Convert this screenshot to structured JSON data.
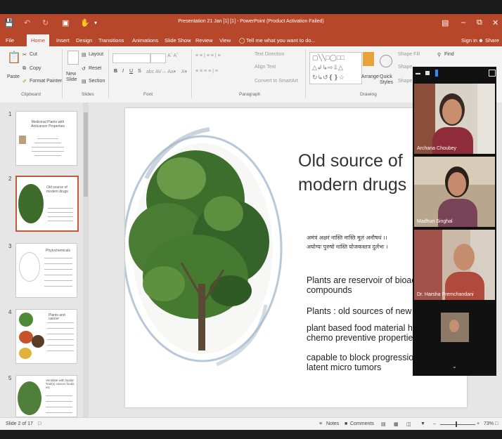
{
  "window": {
    "title": "Presentation 21 Jan [1] [1] - PowerPoint (Product Activation Failed)",
    "sign_in": "Sign in",
    "share": "Share"
  },
  "menu": {
    "file": "File",
    "tabs": [
      "Home",
      "Insert",
      "Design",
      "Transitions",
      "Animations",
      "Slide Show",
      "Review",
      "View"
    ],
    "tell_me": "Tell me what you want to do..."
  },
  "ribbon": {
    "clipboard": {
      "paste": "Paste",
      "cut": "Cut",
      "copy": "Copy",
      "format_painter": "Format Painter",
      "label": "Clipboard"
    },
    "slides": {
      "new_slide": "New Slide",
      "layout": "Layout",
      "reset": "Reset",
      "section": "Section",
      "label": "Slides"
    },
    "font": {
      "label": "Font",
      "bold": "B",
      "italic": "I",
      "underline": "U",
      "strike": "S"
    },
    "paragraph": {
      "text_direction": "Text Direction",
      "align_text": "Align Text",
      "convert_smartart": "Convert to SmartArt",
      "label": "Paragraph"
    },
    "drawing": {
      "arrange": "Arrange",
      "quick_styles": "Quick Styles",
      "shape_fill": "Shape Fill",
      "shape_outline": "Shape",
      "shape_effects": "Shape",
      "label": "Drawing"
    },
    "editing": {
      "find": "Find"
    }
  },
  "thumbnails": [
    {
      "num": "1",
      "title": "Medicinal Plants with Anticancer Properties"
    },
    {
      "num": "2",
      "title": "Old source of modern drugs"
    },
    {
      "num": "3",
      "title": "Phytochemicals"
    },
    {
      "num": "4",
      "title": "Plants and cancer"
    },
    {
      "num": "5",
      "title": "Ventilate with Nodal Tool(s) cancer foods etc"
    }
  ],
  "slide": {
    "title": "Old source of modern drugs",
    "sanskrit_line1": "अमंत्रं अक्षरं नास्ति नास्ति मूलं अनौषधं ।।",
    "sanskrit_line2": "अयोग्यः पुरुषो नास्ति योजकस्तत्र दुर्लभः ।",
    "bullets": [
      [
        "Plants are reservoir of bioac",
        "compounds"
      ],
      [
        "Plants : old sources of new d"
      ],
      [
        "plant based food material ha",
        "chemo preventive propertie"
      ],
      [
        "capable to block progression",
        "latent micro tumors"
      ]
    ]
  },
  "status": {
    "slide_of": "Slide 2 of 17",
    "notes": "Notes",
    "comments": "Comments",
    "zoom": "73%"
  },
  "video_call": {
    "participants": [
      {
        "name": "Archana Choubey"
      },
      {
        "name": "Madhuri Singhal"
      },
      {
        "name": "Dr. Harsha Premchandani"
      }
    ]
  },
  "colors": {
    "accent": "#b7472a",
    "ribbon": "#f3f3f3",
    "selected_thumb": "#c55a3a"
  }
}
